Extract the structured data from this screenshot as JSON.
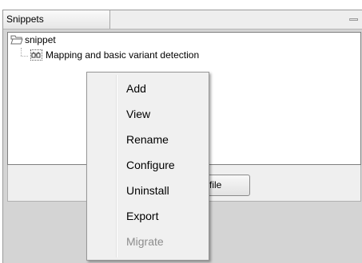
{
  "panel": {
    "tab_title": "Snippets"
  },
  "tree": {
    "root_label": "snippet",
    "child_label": "Mapping and basic variant detection"
  },
  "bottom": {
    "button_label": "file"
  },
  "context_menu": {
    "items": [
      {
        "label": "Add",
        "enabled": true
      },
      {
        "label": "View",
        "enabled": true
      },
      {
        "label": "Rename",
        "enabled": true
      },
      {
        "label": "Configure",
        "enabled": true
      },
      {
        "label": "Uninstall",
        "enabled": true
      },
      {
        "label": "Export",
        "enabled": true
      },
      {
        "label": "Migrate",
        "enabled": false
      }
    ]
  }
}
